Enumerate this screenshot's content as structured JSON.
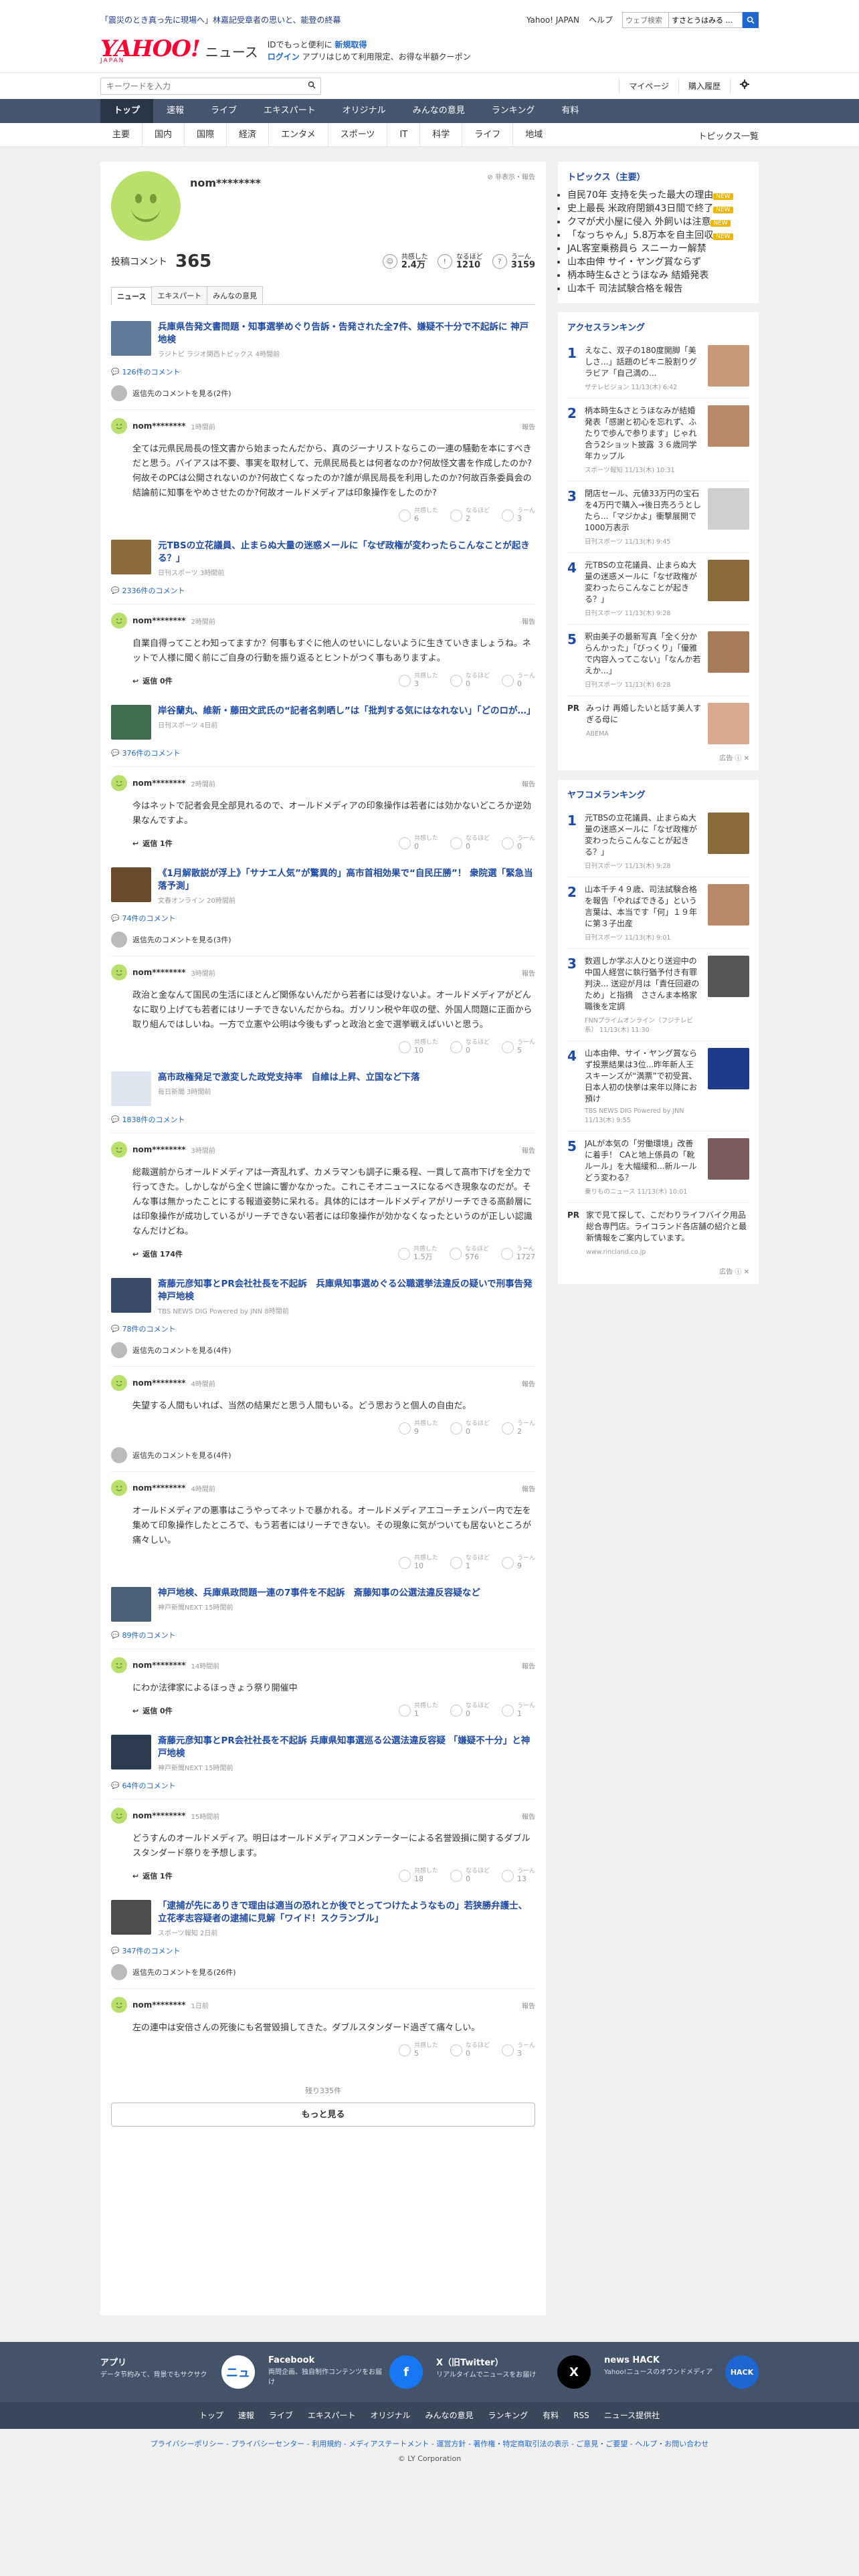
{
  "header": {
    "flash": "「震災のとき真っ先に現場へ」林嘉記受章者の思いと、能登の終幕",
    "links": [
      "Yahoo! JAPAN",
      "ヘルプ"
    ],
    "search_placeholder": "ウェブ検索",
    "search_value": "すさとうはみる ...",
    "logo": "YAHOO!",
    "logo_sub": "JAPAN",
    "brand": "ニュース",
    "promo_line1a": "IDでもっと便利に",
    "promo_line1b": "新規取得",
    "promo_line2a": "ログイン",
    "promo_line2b": "アプリはじめて利用限定、お得な半額クーポン",
    "keyword_placeholder": "キーワードを入力",
    "mypage": "マイページ",
    "history": "購入履歴"
  },
  "gnav": [
    "トップ",
    "速報",
    "ライブ",
    "エキスパート",
    "オリジナル",
    "みんなの意見",
    "ランキング",
    "有料"
  ],
  "subnav": [
    "主要",
    "国内",
    "国際",
    "経済",
    "エンタメ",
    "スポーツ",
    "IT",
    "科学",
    "ライフ",
    "地域"
  ],
  "subnav_right": "トピックス一覧",
  "profile": {
    "name": "nom********",
    "links": "非表示・報告",
    "comments_label": "投稿コメント",
    "comments_count": "365",
    "reactions": [
      {
        "label": "共感した",
        "value": "2.4万"
      },
      {
        "label": "なるほど",
        "value": "1210"
      },
      {
        "label": "うーん",
        "value": "3159"
      }
    ],
    "tabs": [
      "ニュース",
      "エキスパート",
      "みんなの意見"
    ]
  },
  "articles": [
    {
      "title": "兵庫県告発文書問題・知事選挙めぐり告訴・告発された全7件、嫌疑不十分で不起訴に 神戸地検",
      "source": "ラジトピ ラジオ関西トピックス 4時間前",
      "count": "126件のコメント",
      "show_replies": "返信先のコメントを見る(2件)",
      "thumb": "#5d7a9a",
      "comments": [
        {
          "name": "nom********",
          "time": "1時間前",
          "report": "報告",
          "text": "全ては元県民局長の怪文書から始まったんだから、真のジーナリストならこの一連の騒動を本にすべきだと思う。バイアスは不要、事実を取材して、元県民局長とは何者なのか?何故怪文書を作成したのか?何故そのPCは公開されないのか?何故亡くなったのか?誰が県民局長を利用したのか?何故百条委員会の結論前に知事をやめさせたのか?何故オールドメディアは印象操作をしたのか?",
          "reply": "",
          "votes": [
            "6",
            "2",
            "3"
          ]
        }
      ]
    },
    {
      "title": "元TBSの立花議員、止まらぬ大量の迷惑メールに「なぜ政権が変わったらこんなことが起きる？」",
      "source": "日刊スポーツ 3時間前",
      "count": "2336件のコメント",
      "show_replies": "",
      "thumb": "#8a6a3a",
      "comments": [
        {
          "name": "nom********",
          "time": "2時間前",
          "report": "報告",
          "text": "自業自得ってことわ知ってますか？何事もすぐに他人のせいにしないように生きていきましょうね。ネットで人様に聞く前にご自身の行動を振り返るとヒントがつく事もありますよ。",
          "reply": "返信 0件",
          "votes": [
            "3",
            "0",
            "0"
          ]
        }
      ]
    },
    {
      "title": "岸谷蘭丸、維新・藤田文武氏の“記者名刺晒し”は「批判する気にはなれない」「どのロが…」",
      "source": "日刊スポーツ 4日前",
      "count": "376件のコメント",
      "show_replies": "",
      "thumb": "#3f6e4f",
      "comments": [
        {
          "name": "nom********",
          "time": "2時間前",
          "report": "報告",
          "text": "今はネットで記者会見全部見れるので、オールドメディアの印象操作は若者には効かないどころか逆効果なんですよ。",
          "reply": "返信 1件",
          "votes": [
            "0",
            "0",
            "0"
          ]
        }
      ]
    },
    {
      "title": "《1月解散説が浮上》「サナエ人気”が驚異的」高市首相効果で“自民圧勝”！ 衆院選「緊急当落予測」",
      "source": "文春オンライン 20時間前",
      "count": "74件のコメント",
      "show_replies": "返信先のコメントを見る(3件)",
      "thumb": "#6a4a2a",
      "comments": [
        {
          "name": "nom********",
          "time": "3時間前",
          "report": "報告",
          "text": "政治と金なんて国民の生活にほとんど関係ないんだから若者には受けないよ。オールドメディアがどんなに取り上げても若者にはリーチできないんだからね。ガソリン税や年収の壁、外国人問題に正面から取り組んではしいね。一方で立憲や公明は今後もずっと政治と金で選挙戦えばいいと思う。",
          "reply": "",
          "votes": [
            "10",
            "0",
            "5"
          ]
        }
      ]
    },
    {
      "title": "高市政権発足で激変した政党支持率　自維は上昇、立国など下落",
      "source": "毎日新聞 3時間前",
      "count": "1838件のコメント",
      "show_replies": "",
      "thumb": "#dfe6ef",
      "comments": [
        {
          "name": "nom********",
          "time": "3時間前",
          "report": "報告",
          "text": "総裁選前からオールドメディアは一斉乱れず、カメラマンも調子に乗る程、一貫して高市下げを全力で行ってきた。しかしながら全く世論に響かなかった。これこそオニュースになるべき現象なのだが。そんな事は無かったことにする報道姿勢に呆れる。具体的にはオールドメディアがリーチできる高齢層には印象操作が成功しているがリーチできない若者には印象操作が効かなくなったというのが正しい認識なんだけどね。",
          "reply": "返信 174件",
          "votes": [
            "1.5万",
            "576",
            "1727"
          ]
        }
      ]
    },
    {
      "title": "斎藤元彦知事とPR会社社長を不起訴　兵庫県知事選めぐる公職選挙法違反の疑いで刑事告発　神戸地検",
      "source": "TBS NEWS DIG Powered by JNN 8時間前",
      "count": "78件のコメント",
      "show_replies": "返信先のコメントを見る(4件)",
      "thumb": "#3a4a6a",
      "comments": [
        {
          "name": "nom********",
          "time": "4時間前",
          "report": "報告",
          "text": "失望する人間もいれば、当然の結果だと思う人間もいる。どう思おうと個人の自由だ。",
          "reply": "",
          "votes": [
            "9",
            "0",
            "2"
          ]
        },
        {
          "name": "nom********",
          "time": "4時間前",
          "report": "報告",
          "text": "オールドメディアの悪事はこうやってネットで暴かれる。オールドメディアエコーチェンバー内で左を集めて印象操作したところで、もう若者にはリーチできない。その現象に気がついても居ないところが痛々しい。",
          "reply": "",
          "votes": [
            "10",
            "1",
            "9"
          ],
          "pre_replies": "返信先のコメントを見る(4件)"
        }
      ]
    },
    {
      "title": "神戸地検、兵庫県政問題一連の7事件を不起訴　斎藤知事の公選法違反容疑など",
      "source": "神戸新聞NEXT 15時間前",
      "count": "89件のコメント",
      "show_replies": "",
      "thumb": "#4a5f7a",
      "comments": [
        {
          "name": "nom********",
          "time": "14時間前",
          "report": "報告",
          "text": "にわか法律家によるほっきょう祭り開催中",
          "reply": "返信 0件",
          "votes": [
            "1",
            "0",
            "1"
          ]
        }
      ]
    },
    {
      "title": "斎藤元彦知事とPR会社社長を不起訴 兵庫県知事選巡る公選法違反容疑 「嫌疑不十分」と神戸地検",
      "source": "神戸新聞NEXT 15時間前",
      "count": "64件のコメント",
      "show_replies": "",
      "thumb": "#2c3b52",
      "comments": [
        {
          "name": "nom********",
          "time": "15時間前",
          "report": "報告",
          "text": "どうすんのオールドメディア。明日はオールドメディアコメンテーターによる名誉毀損に関するダブルスタンダード祭りを予想します。",
          "reply": "返信 1件",
          "votes": [
            "18",
            "0",
            "13"
          ]
        }
      ]
    },
    {
      "title": "「逮捕が先にありきで理由は適当の恐れとか後でとってつけたようなもの」若狭勝弁護士、立花孝志容疑者の逮捕に見解「ワイド！スクランブル」",
      "source": "スポーツ報知 2日前",
      "count": "347件のコメント",
      "show_replies": "返信先のコメントを見る(26件)",
      "thumb": "#4d4d4d",
      "comments": [
        {
          "name": "nom********",
          "time": "1日前",
          "report": "報告",
          "text": "左の連中は安倍さんの死後にも名誉毀損してきた。ダブルスタンダード過ぎて痛々しい。",
          "reply": "",
          "votes": [
            "5",
            "0",
            "3"
          ]
        }
      ]
    }
  ],
  "vote_labels": [
    "共感した",
    "なるほど",
    "うーん"
  ],
  "remaining": "残り335件",
  "more": "もっと見る",
  "side": {
    "topics_title": "トピックス（主要）",
    "topics": [
      {
        "t": "自民70年 支持を失った最大の理由",
        "b": "NEW"
      },
      {
        "t": "史上最長 米政府閉鎖43日間で終了",
        "b": "NEW"
      },
      {
        "t": "クマが犬小屋に侵入 外飼いは注意",
        "b": "NEW"
      },
      {
        "t": "「なっちゃん」5.8万本を自主回収",
        "b": "NEW"
      },
      {
        "t": "JAL客室乗務員ら スニーカー解禁",
        "b": ""
      },
      {
        "t": "山本由伸 サイ・ヤング賞ならず",
        "b": ""
      },
      {
        "t": "柄本時生&さとうほなみ 結婚発表",
        "b": ""
      },
      {
        "t": "山本千 司法試験合格を報告",
        "b": ""
      }
    ],
    "access_title": "アクセスランキング",
    "access": [
      {
        "n": "1",
        "t": "えなこ、双子の180度開脚「美しさ...」話題のビキニ股割りグラビア「自己満の...",
        "s": "ザテレビジョン 11/13(木) 6:42",
        "c": "#c89a7a"
      },
      {
        "n": "2",
        "t": "柄本時生&さとうほなみが結婚発表「感謝と初心を忘れず、ふたりで歩んで参ります」じゃれ合う2ショット披露 ３６歳同学年カップル",
        "s": "スポーツ報知 11/13(木) 10:31",
        "c": "#b98a6a"
      },
      {
        "n": "3",
        "t": "閉店セール、元値33万円の宝石を4万円で購入→後日売ろうとしたら...「マジかよ」衝撃展開で1000万表示",
        "s": "日刊スポーツ 11/13(木) 9:45",
        "c": "#cfcfcf"
      },
      {
        "n": "4",
        "t": "元TBSの立花議員、止まらぬ大量の迷惑メールに「なぜ政権が変わったらこんなことが起きる？」",
        "s": "日刊スポーツ 11/13(木) 9:28",
        "c": "#8a6a3a"
      },
      {
        "n": "5",
        "t": "釈由美子の最新写真「全く分からんかった」「びっくり」「優雅で内容入ってこない」「なんか若えか...」",
        "s": "日刊スポーツ 11/13(木) 6:28",
        "c": "#a77a5a"
      }
    ],
    "pr1_tag": "PR",
    "pr1_text": "みっけ 再婚したいと話す美人すぎる母に",
    "pr1_src": "ABEMA",
    "ad": "広告",
    "yafoko_title": "ヤフコメランキング",
    "yafoko": [
      {
        "n": "1",
        "t": "元TBSの立花議員、止まらぬ大量の迷惑メールに「なぜ政権が変わったらこんなことが起きる？」",
        "s": "日刊スポーツ 11/13(木) 9:28",
        "c": "#8a6a3a"
      },
      {
        "n": "2",
        "t": "山本千チ４９歳、司法試験合格を報告「やればできる」という言葉は、本当です「何」１９年に第３子出産",
        "s": "日刊スポーツ 11/13(木) 9:01",
        "c": "#b98a6a"
      },
      {
        "n": "3",
        "t": "数週しか学ぶ人ひとり送迎中の中国人経営に執行猶予付き有罪判決... 送迎が月は「責任回避のため」と指摘　ささんま本格家職後を定調",
        "s": "FNNプライムオンライン（フジテレビ系） 11/13(木) 11:30",
        "c": "#555555"
      },
      {
        "n": "4",
        "t": "山本由伸、サイ・ヤング賞ならず投票結果は3位...昨年新人王スキーンズが“満票”で初受賞、日本人初の快挙は来年以降にお預け",
        "s": "TBS NEWS DIG Powered by JNN 11/13(木) 9:55",
        "c": "#1e3a8a"
      },
      {
        "n": "5",
        "t": "JALが本気の「労働環境」改善に着手！ CAと地上係員の「靴ルール」を大幅緩和...新ルールどう変わる？",
        "s": "乗りものニュース 11/13(木) 10:01",
        "c": "#7a5a5a"
      }
    ],
    "pr2_tag": "PR",
    "pr2_text": "家で見て探して、こだわりライフバイク用品総合専門店。ライコランド各店舗の紹介と最新情報をご案内しています。",
    "pr2_src": "www.rincland.co.jp"
  },
  "footer": {
    "apps": [
      {
        "t": "アプリ",
        "d": "データ节約みて、背景でもサクサク",
        "icon": "ニュ"
      },
      {
        "t": "Facebook",
        "d": "両問企画、独自制作コンテンツをお届け",
        "icon": "f"
      },
      {
        "t": "X（旧Twitter）",
        "d": "リアルタイムでニュースをお届け",
        "icon": "X"
      },
      {
        "t": "news HACK",
        "d": "Yahoo!ニュースのオウンドメディア",
        "icon": "HACK"
      }
    ],
    "nav": [
      "トップ",
      "速報",
      "ライブ",
      "エキスパート",
      "オリジナル",
      "みんなの意見",
      "ランキング",
      "有料",
      "RSS",
      "ニュース提供社"
    ],
    "links": "プライバシーポリシー - プライバシーセンター - 利用規約 - メディアステートメント - 運営方針 - 著作権・特定商取引法の表示 - ご意見・ご要望 - ヘルプ・お問い合わせ",
    "copy": "© LY Corporation"
  }
}
